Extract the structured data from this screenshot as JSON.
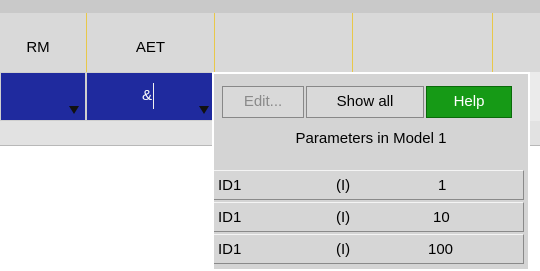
{
  "columns": [
    {
      "label": "RM"
    },
    {
      "label": "AET"
    },
    {
      "label": ""
    },
    {
      "label": ""
    },
    {
      "label": ""
    }
  ],
  "row": {
    "aet_value": "&"
  },
  "popup": {
    "edit_label": "Edit...",
    "show_all_label": "Show all",
    "help_label": "Help",
    "title": "Parameters in Model 1",
    "rows": [
      {
        "name": "ID1",
        "type": "(I)",
        "value": "1"
      },
      {
        "name": "ID1",
        "type": "(I)",
        "value": "10"
      },
      {
        "name": "ID1",
        "type": "(I)",
        "value": "100"
      }
    ]
  }
}
